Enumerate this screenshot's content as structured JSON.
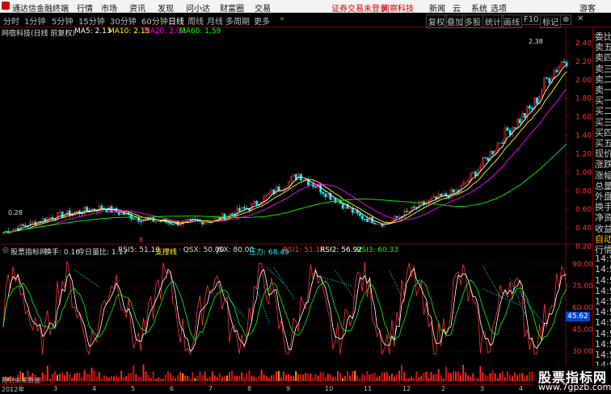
{
  "menubar": {
    "app_title": "通达信金融终端",
    "menus": [
      "行情",
      "市场",
      "资讯",
      "发现",
      "问小达",
      "财富圈",
      "交易"
    ],
    "notice": "证券交易未登录",
    "brand": "网察科技",
    "links": [
      "新闻",
      "云",
      "系统",
      "选项"
    ],
    "guest": "游客"
  },
  "toolbar": {
    "periods": [
      "分时",
      "1分钟",
      "5分钟",
      "15分钟",
      "30分钟",
      "60分钟",
      "日线",
      "周线",
      "月线",
      "多周期",
      "更多"
    ],
    "active_period": "日线",
    "buttons": [
      "复权",
      "叠加",
      "多股",
      "统计",
      "画线",
      "F10",
      "标记",
      "⊕"
    ]
  },
  "main_chart": {
    "stock_name": "网宿科技(日线 前复权)",
    "ma_legend": [
      {
        "text": "MA5: 2.13",
        "color": "#ffffff"
      },
      {
        "text": "MA10: 2.15",
        "color": "#ffff00"
      },
      {
        "text": "MA20: 2.02",
        "color": "#ff00ff"
      },
      {
        "text": "MA60: 1.59",
        "color": "#00ff00"
      }
    ],
    "high_label": "2.38",
    "low_label": "0.28",
    "y_ticks": [
      "2.40",
      "2.20",
      "2.00",
      "1.80",
      "1.60",
      "1.40",
      "1.20",
      "1.00",
      "0.80",
      "0.60",
      "0.40",
      "0.20"
    ],
    "low_marker": "8"
  },
  "indicator": {
    "name": "股票指标网",
    "items": [
      {
        "text": "换手: 0.16",
        "color": "#dddddd"
      },
      {
        "text": "今日量比: 1.17",
        "color": "#dddddd"
      },
      {
        "text": "RSI5: 51.18",
        "color": "#dddddd"
      },
      {
        "text": "支撑线",
        "color": "#ffff00"
      },
      {
        "text": "· QSX: 50.00",
        "color": "#dddddd"
      },
      {
        "text": "JSX: 80.00",
        "color": "#dddddd"
      },
      {
        "text": "压力: 68.49",
        "color": "#00ffff"
      },
      {
        "text": "RSI1: 51.18",
        "color": "#ff3333"
      },
      {
        "text": "RSI2: 56.92",
        "color": "#ffffff"
      },
      {
        "text": "RSI3: 60.33",
        "color": "#00ff00"
      }
    ],
    "y_ticks": [
      "90.00",
      "75.00",
      "60.00",
      "45.00",
      "30.00"
    ],
    "current_value": "45.62",
    "footnote": "用到未来数据"
  },
  "x_axis": {
    "labels": [
      "2012年",
      "3",
      "4",
      "5",
      "6",
      "7",
      "8",
      "9",
      "10",
      "11",
      "12",
      "2",
      "3",
      "4",
      "5"
    ]
  },
  "right_panel": {
    "items": [
      "委比",
      "卖五",
      "卖四",
      "卖三",
      "卖二",
      "卖一",
      "买一",
      "买二",
      "买三",
      "买四",
      "买五",
      "现价",
      "涨跌",
      "涨幅",
      "总量",
      "外盘",
      "换手",
      "净资",
      "收益",
      "自动",
      "行情",
      "14:5",
      "14:5",
      "14:5",
      "14:5",
      "14:5",
      "14:5",
      "14:5",
      "14:5",
      "14:5",
      "14:5",
      "14:5"
    ]
  },
  "watermark": {
    "title": "股票指标网",
    "url": "www.7gpzb.com"
  },
  "colors": {
    "ma5": "#ffffff",
    "ma10": "#ffff00",
    "ma20": "#ff00ff",
    "ma60": "#00ff00",
    "up": "#ff3333",
    "down": "#00ffff",
    "axis": "#800000"
  }
}
